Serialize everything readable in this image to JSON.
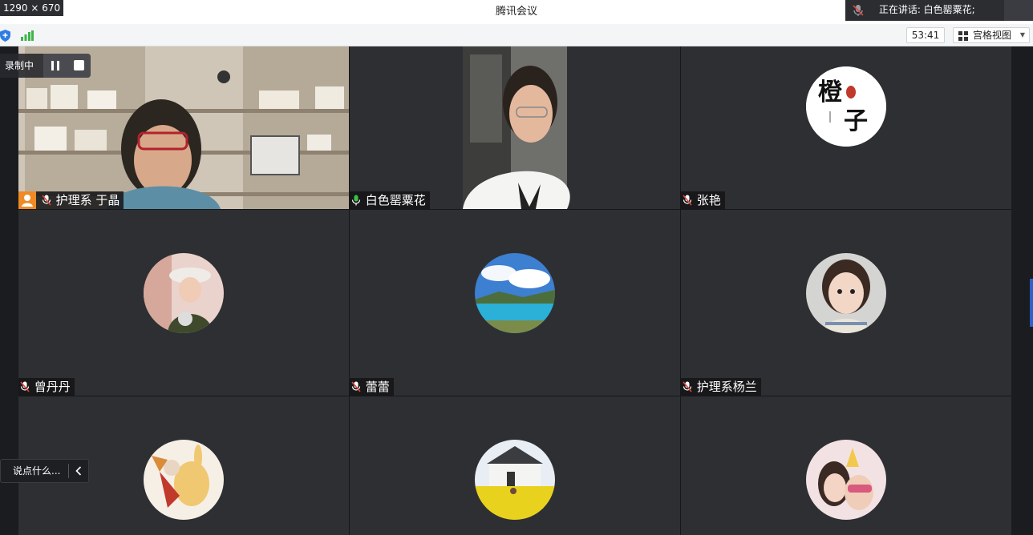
{
  "window": {
    "dimensions_badge": "1290 × 670",
    "title": "腾讯会议",
    "speaking_label": "正在讲话: 白色罂粟花;"
  },
  "toolbar": {
    "timer": "53:41",
    "view_mode": "宫格视图",
    "icons": [
      "shield-icon",
      "signal-strength-icon",
      "grid-view-icon",
      "caret-down-icon"
    ]
  },
  "recording": {
    "label": "录制中"
  },
  "chat": {
    "placeholder": "说点什么..."
  },
  "colors": {
    "tile_bg": "#2e2f33",
    "active_speaker_border": "#4fbf5a",
    "host_badge": "#f08a24",
    "mic_on": "#3cc24a",
    "mic_off": "#e2453c"
  },
  "participants": [
    {
      "name": "护理系 于晶",
      "kind": "video-bookshelf",
      "host": true,
      "mic": "off"
    },
    {
      "name": "白色罂粟花",
      "kind": "video-portrait",
      "host": false,
      "mic": "on",
      "active": true
    },
    {
      "name": "张艳",
      "kind": "avatar-logo",
      "host": false,
      "mic": "off",
      "logo_text": "橙子"
    },
    {
      "name": "曾丹丹",
      "kind": "avatar-girl-hat",
      "host": false,
      "mic": "off"
    },
    {
      "name": "蕾蕾",
      "kind": "avatar-landscape",
      "host": false,
      "mic": "off"
    },
    {
      "name": "护理系杨兰",
      "kind": "avatar-child",
      "host": false,
      "mic": "off"
    },
    {
      "name": "",
      "kind": "avatar-cartoon",
      "host": false,
      "mic": "off"
    },
    {
      "name": "",
      "kind": "avatar-house-flowers",
      "host": false,
      "mic": "off"
    },
    {
      "name": "",
      "kind": "avatar-couple",
      "host": false,
      "mic": "off"
    }
  ]
}
